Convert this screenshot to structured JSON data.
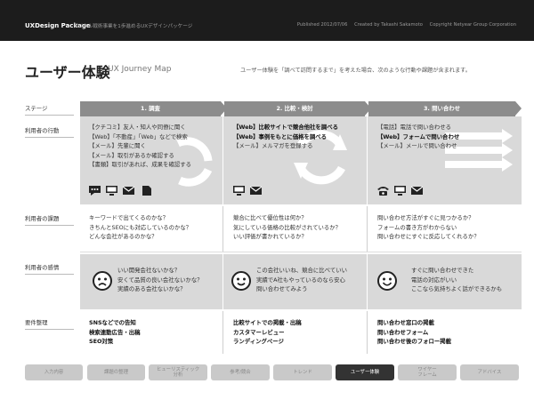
{
  "header": {
    "brand": "UXDesign Package",
    "tagline": "デジタル戦術事業を1歩進めるUXデザインパッケージ",
    "published": "Published 2012/07/06",
    "created": "Created by Takashi Sakamoto",
    "copyright": "Copyright Netyear Group Corporation"
  },
  "page": {
    "title": "ユーザー体験",
    "subtitle": "UX Journey Map",
    "intro": "ユーザー体験を「調べて訪問するまで」を考えた場合、次のような行動や課題が含まれます。"
  },
  "rows": {
    "stage": "ステージ",
    "action": "利用者の行動",
    "issue": "利用者の課題",
    "emotion": "利用者の感情",
    "requirement": "要件整理"
  },
  "stages": [
    "1. 調査",
    "2. 比較・検討",
    "3. 問い合わせ"
  ],
  "actions": [
    [
      "【クチコミ】友人・知人や同僚に聞く",
      "【Web】「不動産」「Web」などで検索",
      "【メール】先輩に聞く",
      "【メール】取引があるか確認する",
      "【書類】取引があれば、成果を確認する"
    ],
    [
      "【Web】比較サイトで競合他社を調べる",
      "【Web】事例をもとに価格を調べる",
      "【メール】メルマガを登録する"
    ],
    [
      "【電話】電話で問い合わせる",
      "【Web】フォームで問い合わせ",
      "【メール】メールで問い合わせ"
    ]
  ],
  "issues": [
    [
      "キーワードで出てくるのかな？",
      "きちんとSEOにも対応しているのかな？",
      "どんな会社があるのかな？"
    ],
    [
      "競合に比べて優位性は何か？",
      "気にしている価格の比較がされているか？",
      "いい評価が書かれているか？"
    ],
    [
      "問い合わせ方法がすぐに見つかるか？",
      "フォームの書き方がわからない",
      "問い合わせにすぐに反応してくれるか？"
    ]
  ],
  "emotions": [
    [
      "いい開発会社ないかな？",
      "安くて品質の良い会社ないかな？",
      "実績のある会社ないかな？"
    ],
    [
      "この会社いいね、競合に比べていい",
      "実績でA社もやっているのなら安心",
      "問い合わせてみよう"
    ],
    [
      "すぐに問い合わせできた",
      "電話の対応がいい",
      "ここなら気持ちよく話ができるかも"
    ]
  ],
  "requirements": [
    [
      "SNSなどでの告知",
      "検索連動広告・出稿",
      "SEO対策"
    ],
    [
      "比較サイトでの掲載・出稿",
      "カスタマーレビュー",
      "ランディングページ"
    ],
    [
      "問い合わせ窓口の掲載",
      "問い合わせフォーム",
      "問い合わせ後のフォロー掲載"
    ]
  ],
  "nav": [
    [
      "入力内容"
    ],
    [
      "課題の整理"
    ],
    [
      "ヒューリスティック",
      "分析"
    ],
    [
      "参考/競合"
    ],
    [
      "トレンド"
    ],
    [
      "ユーザー体験"
    ],
    [
      "ワイヤー",
      "フレーム"
    ],
    [
      "アドバイス"
    ]
  ],
  "nav_active": "ユーザー体験",
  "colors": {
    "topbar": "#1c1c1c",
    "stage": "#8c8c8c",
    "band": "#d9d9d9",
    "active": "#333333"
  }
}
